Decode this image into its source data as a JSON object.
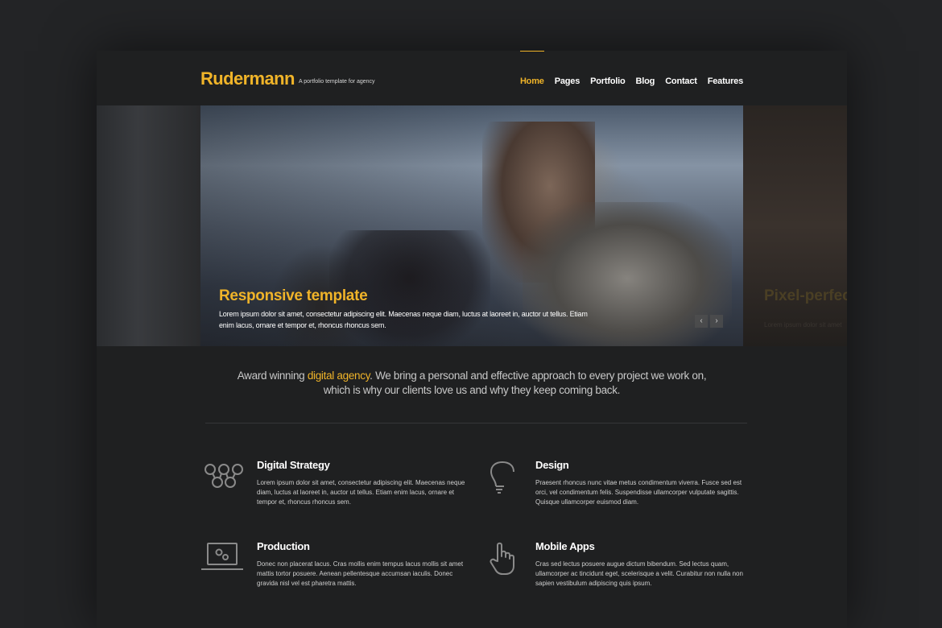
{
  "brand": {
    "logo": "Rudermann",
    "tagline": "A portfolio template for agency"
  },
  "nav": {
    "items": [
      {
        "label": "Home"
      },
      {
        "label": "Pages"
      },
      {
        "label": "Portfolio"
      },
      {
        "label": "Blog"
      },
      {
        "label": "Contact"
      },
      {
        "label": "Features"
      }
    ]
  },
  "slider": {
    "title": "Responsive template",
    "text": "Lorem ipsum dolor sit amet, consectetur adipiscing elit. Maecenas neque diam, luctus at laoreet in, auctor ut tellus. Etiam enim lacus, ornare et tempor et, rhoncus rhoncus sem.",
    "next_slide_title": "Pixel-perfect",
    "next_slide_text": "Lorem ipsum dolor sit amet",
    "prev_arrow": "‹",
    "next_arrow": "›"
  },
  "intro": {
    "before": "Award winning ",
    "highlight": "digital agency",
    "after_line1": ". We bring a personal and effective approach to every project we work on,",
    "line2": "which is why our clients love us and why they keep coming back."
  },
  "features": [
    {
      "title": "Digital Strategy",
      "text": "Lorem ipsum dolor sit amet, consectetur adipiscing elit. Maecenas neque diam, luctus at laoreet in, auctor ut tellus. Etiam enim lacus, ornare et tempor et, rhoncus rhoncus sem.",
      "icon": "network-icon"
    },
    {
      "title": "Design",
      "text": "Praesent rhoncus nunc vitae metus condimentum viverra. Fusce sed est orci, vel condimentum felis. Suspendisse ullamcorper vulputate sagittis. Quisque ullamcorper euismod diam.",
      "icon": "lightbulb-icon"
    },
    {
      "title": "Production",
      "text": "Donec non placerat lacus. Cras mollis enim tempus lacus mollis sit amet mattis tortor posuere. Aenean pellentesque accumsan iaculis. Donec gravida nisl vel est pharetra mattis.",
      "icon": "laptop-gears-icon"
    },
    {
      "title": "Mobile Apps",
      "text": "Cras sed lectus posuere augue dictum bibendum. Sed lectus quam, ullamcorper ac tincidunt eget, scelerisque a velit. Curabitur non nulla non sapien vestibulum adipiscing quis ipsum.",
      "icon": "hand-pointer-icon"
    }
  ],
  "colors": {
    "accent": "#f0b429",
    "background": "#1f2021",
    "text": "#ffffff"
  }
}
